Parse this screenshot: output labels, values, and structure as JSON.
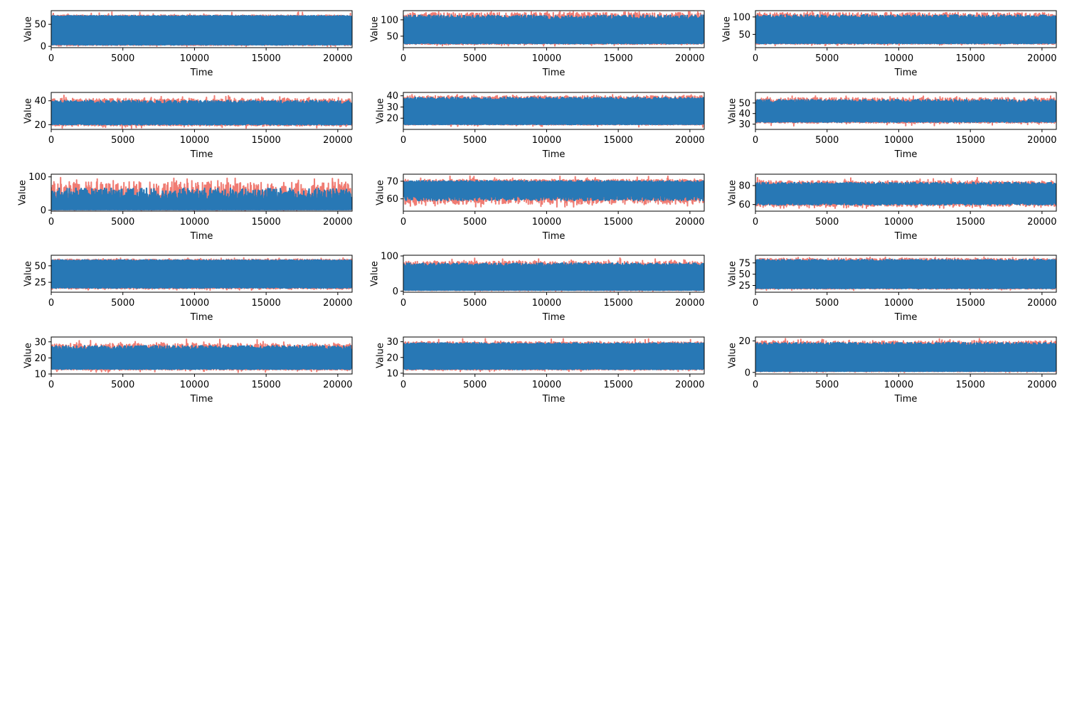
{
  "colors": {
    "actual": "#f07c73",
    "fitted": "#2878b5",
    "frame": "#000000",
    "background": "#ffffff"
  },
  "chart_data": [
    {
      "type": "line",
      "xlabel": "Time",
      "ylabel": "Value",
      "xlim": [
        0,
        21000
      ],
      "xticks": [
        0,
        5000,
        10000,
        15000,
        20000
      ],
      "yticks": [
        0,
        50
      ],
      "ylim": [
        -3,
        81
      ],
      "envelope": {
        "top": 71,
        "bottom": 2,
        "median_top": 67,
        "median_bottom": 5,
        "peak": 78,
        "floor": 0
      },
      "series": [
        {
          "color": "#f07c73"
        },
        {
          "color": "#2878b5"
        }
      ]
    },
    {
      "type": "line",
      "xlabel": "Time",
      "ylabel": "Value",
      "xlim": [
        0,
        21000
      ],
      "xticks": [
        0,
        5000,
        10000,
        15000,
        20000
      ],
      "yticks": [
        50,
        100
      ],
      "ylim": [
        15,
        128
      ],
      "envelope": {
        "top": 122,
        "bottom": 25,
        "median_top": 100,
        "median_bottom": 30,
        "peak": 125,
        "floor": 20
      },
      "series": [
        {
          "color": "#f07c73"
        },
        {
          "color": "#2878b5"
        }
      ]
    },
    {
      "type": "line",
      "xlabel": "Time",
      "ylabel": "Value",
      "xlim": [
        0,
        21000
      ],
      "xticks": [
        0,
        5000,
        10000,
        15000,
        20000
      ],
      "yticks": [
        50,
        100
      ],
      "ylim": [
        12,
        118
      ],
      "envelope": {
        "top": 112,
        "bottom": 22,
        "median_top": 95,
        "median_bottom": 26,
        "peak": 115,
        "floor": 18
      },
      "series": [
        {
          "color": "#f07c73"
        },
        {
          "color": "#2878b5"
        }
      ]
    },
    {
      "type": "line",
      "xlabel": "Time",
      "ylabel": "Value",
      "xlim": [
        0,
        21000
      ],
      "xticks": [
        0,
        5000,
        10000,
        15000,
        20000
      ],
      "yticks": [
        20,
        40
      ],
      "ylim": [
        16,
        47
      ],
      "envelope": {
        "top": 42,
        "bottom": 19,
        "median_top": 37,
        "median_bottom": 21,
        "peak": 45,
        "floor": 17
      },
      "series": [
        {
          "color": "#f07c73"
        },
        {
          "color": "#2878b5"
        }
      ]
    },
    {
      "type": "line",
      "xlabel": "Time",
      "ylabel": "Value",
      "xlim": [
        0,
        21000
      ],
      "xticks": [
        0,
        5000,
        10000,
        15000,
        20000
      ],
      "yticks": [
        20,
        30,
        40
      ],
      "ylim": [
        10,
        43
      ],
      "envelope": {
        "top": 40,
        "bottom": 14,
        "median_top": 36,
        "median_bottom": 15,
        "peak": 41,
        "floor": 12
      },
      "series": [
        {
          "color": "#f07c73"
        },
        {
          "color": "#2878b5"
        }
      ]
    },
    {
      "type": "line",
      "xlabel": "Time",
      "ylabel": "Value",
      "xlim": [
        0,
        21000
      ],
      "xticks": [
        0,
        5000,
        10000,
        15000,
        20000
      ],
      "yticks": [
        30,
        40,
        50
      ],
      "ylim": [
        25,
        60
      ],
      "envelope": {
        "top": 55,
        "bottom": 31,
        "median_top": 50,
        "median_bottom": 33,
        "peak": 57,
        "floor": 28
      },
      "series": [
        {
          "color": "#f07c73"
        },
        {
          "color": "#2878b5"
        }
      ]
    },
    {
      "type": "line",
      "xlabel": "Time",
      "ylabel": "Value",
      "xlim": [
        0,
        21000
      ],
      "xticks": [
        0,
        5000,
        10000,
        15000,
        20000
      ],
      "yticks": [
        0,
        100
      ],
      "ylim": [
        -3,
        108
      ],
      "envelope": {
        "top": 85,
        "bottom": 1,
        "median_top": 30,
        "median_bottom": 2,
        "peak": 100,
        "floor": 0
      },
      "series": [
        {
          "color": "#f07c73"
        },
        {
          "color": "#2878b5"
        }
      ]
    },
    {
      "type": "line",
      "xlabel": "Time",
      "ylabel": "Value",
      "xlim": [
        0,
        21000
      ],
      "xticks": [
        0,
        5000,
        10000,
        15000,
        20000
      ],
      "yticks": [
        60,
        70
      ],
      "ylim": [
        53,
        74
      ],
      "envelope": {
        "top": 71,
        "bottom": 57,
        "median_top": 69,
        "median_bottom": 62,
        "peak": 73,
        "floor": 55
      },
      "series": [
        {
          "color": "#f07c73"
        },
        {
          "color": "#2878b5"
        }
      ]
    },
    {
      "type": "line",
      "xlabel": "Time",
      "ylabel": "Value",
      "xlim": [
        0,
        21000
      ],
      "xticks": [
        0,
        5000,
        10000,
        15000,
        20000
      ],
      "yticks": [
        60,
        80
      ],
      "ylim": [
        53,
        92
      ],
      "envelope": {
        "top": 85,
        "bottom": 58,
        "median_top": 80,
        "median_bottom": 62,
        "peak": 89,
        "floor": 56
      },
      "series": [
        {
          "color": "#f07c73"
        },
        {
          "color": "#2878b5"
        }
      ]
    },
    {
      "type": "line",
      "xlabel": "Time",
      "ylabel": "Value",
      "xlim": [
        0,
        21000
      ],
      "xticks": [
        0,
        5000,
        10000,
        15000,
        20000
      ],
      "yticks": [
        25,
        50
      ],
      "ylim": [
        10,
        66
      ],
      "envelope": {
        "top": 60,
        "bottom": 15,
        "median_top": 57,
        "median_bottom": 18,
        "peak": 62,
        "floor": 13
      },
      "series": [
        {
          "color": "#f07c73"
        },
        {
          "color": "#2878b5"
        }
      ]
    },
    {
      "type": "line",
      "xlabel": "Time",
      "ylabel": "Value",
      "xlim": [
        0,
        21000
      ],
      "xticks": [
        0,
        5000,
        10000,
        15000,
        20000
      ],
      "yticks": [
        0,
        100
      ],
      "ylim": [
        -3,
        102
      ],
      "envelope": {
        "top": 85,
        "bottom": 2,
        "median_top": 70,
        "median_bottom": 4,
        "peak": 95,
        "floor": 0
      },
      "series": [
        {
          "color": "#f07c73"
        },
        {
          "color": "#2878b5"
        }
      ]
    },
    {
      "type": "line",
      "xlabel": "Time",
      "ylabel": "Value",
      "xlim": [
        0,
        21000
      ],
      "xticks": [
        0,
        5000,
        10000,
        15000,
        20000
      ],
      "yticks": [
        25,
        50,
        75
      ],
      "ylim": [
        10,
        92
      ],
      "envelope": {
        "top": 85,
        "bottom": 17,
        "median_top": 78,
        "median_bottom": 20,
        "peak": 88,
        "floor": 14
      },
      "series": [
        {
          "color": "#f07c73"
        },
        {
          "color": "#2878b5"
        }
      ]
    },
    {
      "type": "line",
      "xlabel": "Time",
      "ylabel": "Value",
      "xlim": [
        0,
        21000
      ],
      "xticks": [
        0,
        5000,
        10000,
        15000,
        20000
      ],
      "yticks": [
        10,
        20,
        30
      ],
      "ylim": [
        10,
        33
      ],
      "envelope": {
        "top": 29,
        "bottom": 12.5,
        "median_top": 25,
        "median_bottom": 13.5,
        "peak": 32,
        "floor": 11
      },
      "series": [
        {
          "color": "#f07c73"
        },
        {
          "color": "#2878b5"
        }
      ]
    },
    {
      "type": "line",
      "xlabel": "Time",
      "ylabel": "Value",
      "xlim": [
        0,
        21000
      ],
      "xticks": [
        0,
        5000,
        10000,
        15000,
        20000
      ],
      "yticks": [
        10,
        20,
        30
      ],
      "ylim": [
        9.5,
        33
      ],
      "envelope": {
        "top": 30,
        "bottom": 12,
        "median_top": 28,
        "median_bottom": 13,
        "peak": 32,
        "floor": 11
      },
      "series": [
        {
          "color": "#f07c73"
        },
        {
          "color": "#2878b5"
        }
      ]
    },
    {
      "type": "line",
      "xlabel": "Time",
      "ylabel": "Value",
      "xlim": [
        0,
        21000
      ],
      "xticks": [
        0,
        5000,
        10000,
        15000,
        20000
      ],
      "yticks": [
        0,
        20
      ],
      "ylim": [
        -1,
        22.5
      ],
      "envelope": {
        "top": 20,
        "bottom": 0.5,
        "median_top": 17,
        "median_bottom": 1,
        "peak": 21.5,
        "floor": 0
      },
      "series": [
        {
          "color": "#f07c73"
        },
        {
          "color": "#2878b5"
        }
      ]
    }
  ]
}
